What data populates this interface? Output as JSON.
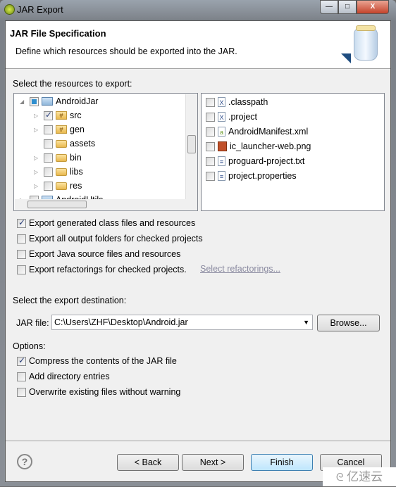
{
  "window": {
    "title": "JAR Export",
    "minimize": "—",
    "maximize": "□",
    "close": "X"
  },
  "header": {
    "title": "JAR File Specification",
    "description": "Define which resources should be exported into the JAR."
  },
  "resources": {
    "label": "Select the resources to export:",
    "tree": [
      {
        "label": "AndroidJar",
        "state": "partial",
        "level": 0,
        "expander": "expanded",
        "icon": "project-icon"
      },
      {
        "label": "src",
        "state": "checked",
        "level": 1,
        "expander": "collapsed",
        "icon": "package-folder-icon"
      },
      {
        "label": "gen",
        "state": "unchecked",
        "level": 1,
        "expander": "collapsed",
        "icon": "package-folder-icon"
      },
      {
        "label": "assets",
        "state": "unchecked",
        "level": 1,
        "expander": "none",
        "icon": "folder-icon"
      },
      {
        "label": "bin",
        "state": "unchecked",
        "level": 1,
        "expander": "collapsed",
        "icon": "folder-icon"
      },
      {
        "label": "libs",
        "state": "unchecked",
        "level": 1,
        "expander": "collapsed",
        "icon": "folder-icon"
      },
      {
        "label": "res",
        "state": "unchecked",
        "level": 1,
        "expander": "collapsed",
        "icon": "folder-icon"
      },
      {
        "label": "AndroidUtils",
        "state": "unchecked",
        "level": 0,
        "expander": "collapsed",
        "icon": "project-icon"
      }
    ],
    "files": [
      {
        "label": ".classpath",
        "icon": "xml-file-icon"
      },
      {
        "label": ".project",
        "icon": "xml-file-icon"
      },
      {
        "label": "AndroidManifest.xml",
        "icon": "android-manifest-icon"
      },
      {
        "label": "ic_launcher-web.png",
        "icon": "image-file-icon"
      },
      {
        "label": "proguard-project.txt",
        "icon": "text-file-icon"
      },
      {
        "label": "project.properties",
        "icon": "text-file-icon"
      }
    ]
  },
  "export_options": [
    {
      "label": "Export generated class files and resources",
      "checked": true
    },
    {
      "label": "Export all output folders for checked projects",
      "checked": false
    },
    {
      "label": "Export Java source files and resources",
      "checked": false
    },
    {
      "label": "Export refactorings for checked projects.",
      "checked": false
    }
  ],
  "select_refactorings": "Select refactorings...",
  "destination": {
    "label": "Select the export destination:",
    "jar_label": "JAR file:",
    "jar_value": "C:\\Users\\ZHF\\Desktop\\Android.jar",
    "browse": "Browse..."
  },
  "options": {
    "label": "Options:",
    "items": [
      {
        "label": "Compress the contents of the JAR file",
        "checked": true
      },
      {
        "label": "Add directory entries",
        "checked": false
      },
      {
        "label": "Overwrite existing files without warning",
        "checked": false
      }
    ]
  },
  "buttons": {
    "back": "< Back",
    "next": "Next >",
    "finish": "Finish",
    "cancel": "Cancel",
    "help": "?"
  },
  "watermark": "亿速云",
  "colors": {
    "accent": "#3c7fb1",
    "link": "#8a8aa0"
  }
}
